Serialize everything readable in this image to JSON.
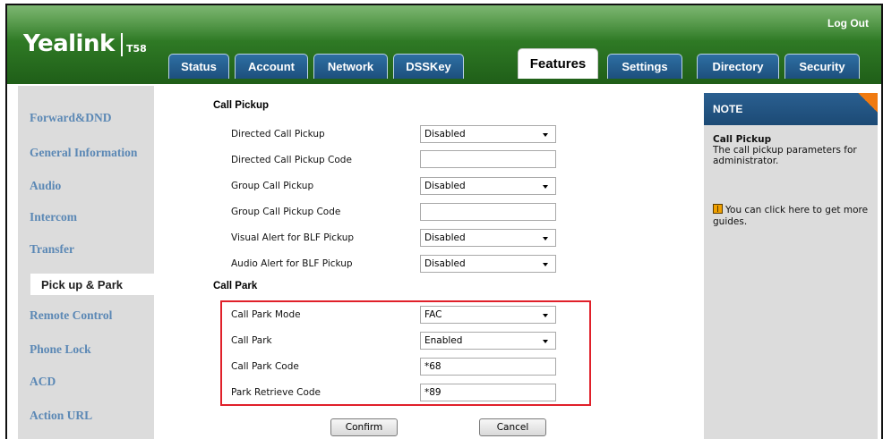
{
  "app": {
    "logo": "Yealink",
    "model": "T58",
    "logout": "Log Out"
  },
  "tabs": [
    {
      "label": "Status"
    },
    {
      "label": "Account"
    },
    {
      "label": "Network"
    },
    {
      "label": "DSSKey"
    },
    {
      "label": "Features",
      "active": true
    },
    {
      "label": "Settings"
    },
    {
      "label": "Directory"
    },
    {
      "label": "Security"
    }
  ],
  "sidebar": {
    "items": [
      {
        "label": "Forward&DND"
      },
      {
        "label": "General Information"
      },
      {
        "label": "Audio"
      },
      {
        "label": "Intercom"
      },
      {
        "label": "Transfer"
      },
      {
        "label": "Pick up & Park",
        "active": true
      },
      {
        "label": "Remote Control"
      },
      {
        "label": "Phone Lock"
      },
      {
        "label": "ACD"
      },
      {
        "label": "Action URL"
      }
    ]
  },
  "pickup": {
    "title": "Call Pickup",
    "rows": [
      {
        "label": "Directed Call Pickup",
        "type": "select",
        "value": "Disabled"
      },
      {
        "label": "Directed Call Pickup Code",
        "type": "input",
        "value": ""
      },
      {
        "label": "Group Call Pickup",
        "type": "select",
        "value": "Disabled"
      },
      {
        "label": "Group Call Pickup Code",
        "type": "input",
        "value": ""
      },
      {
        "label": "Visual Alert for BLF Pickup",
        "type": "select",
        "value": "Disabled"
      },
      {
        "label": "Audio Alert for BLF Pickup",
        "type": "select",
        "value": "Disabled"
      }
    ]
  },
  "park": {
    "title": "Call Park",
    "rows": [
      {
        "label": "Call Park Mode",
        "type": "select",
        "value": "FAC"
      },
      {
        "label": "Call Park",
        "type": "select",
        "value": "Enabled"
      },
      {
        "label": "Call Park Code",
        "type": "input",
        "value": "*68"
      },
      {
        "label": "Park Retrieve Code",
        "type": "input",
        "value": "*89"
      }
    ]
  },
  "buttons": {
    "confirm": "Confirm",
    "cancel": "Cancel"
  },
  "note": {
    "header": "NOTE",
    "title": "Call Pickup",
    "text": "The call pickup parameters for administrator.",
    "guide": "You can click here to get more guides."
  },
  "colors": {
    "header_green": "#2f7a25",
    "tab_blue": "#1d4f7d",
    "sidebar_link": "#5b88b5",
    "note_accent": "#f07a10",
    "highlight_red": "#e0202a"
  }
}
